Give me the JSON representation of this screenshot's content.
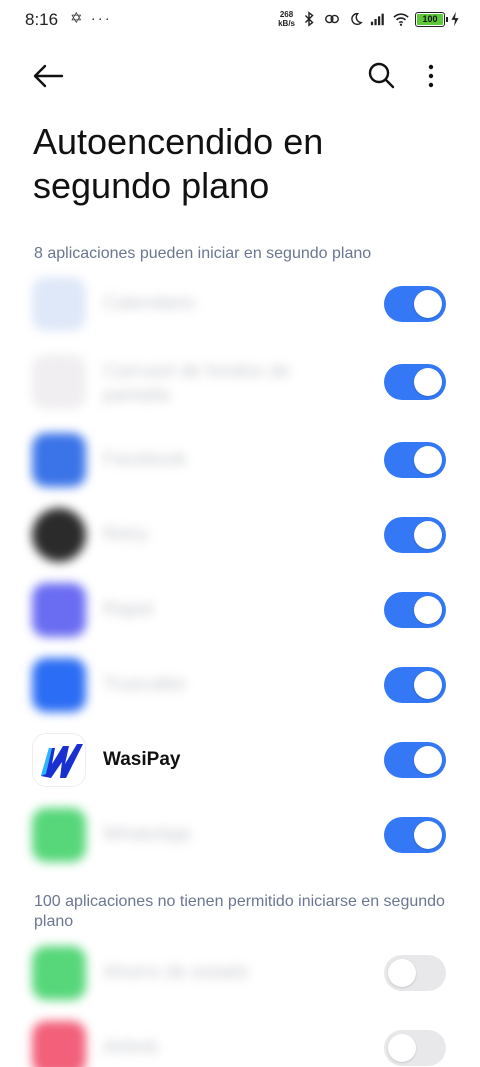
{
  "status_bar": {
    "time": "8:16",
    "left_icons": "✡ ···",
    "net_speed_value": "268",
    "net_speed_unit": "kB/s",
    "battery_level": "100"
  },
  "header": {
    "title": "Autoencendido en segundo plano"
  },
  "allowed_section": {
    "header": "8 aplicaciones pueden iniciar en segundo plano",
    "apps": [
      {
        "name": "Calendario",
        "enabled": true,
        "icon_color": "#dfe8f8",
        "label_color": "#c7c9ce"
      },
      {
        "name": "Carrusel de fondos de pantalla",
        "enabled": true,
        "icon_color": "#f0eef0",
        "label_color": "#c7c9ce"
      },
      {
        "name": "Facebook",
        "enabled": true,
        "icon_color": "#3b74e8",
        "label_color": "#c7c9ce"
      },
      {
        "name": "Retry",
        "enabled": true,
        "icon_color": "#2b2b2b",
        "label_color": "#c7c9ce"
      },
      {
        "name": "Rapid",
        "enabled": true,
        "icon_color": "#6a6cf2",
        "label_color": "#c7c9ce"
      },
      {
        "name": "Truecaller",
        "enabled": true,
        "icon_color": "#2b6df4",
        "label_color": "#c7c9ce"
      },
      {
        "name": "WasiPay",
        "enabled": true,
        "icon_color": "#ffffff",
        "label_color": "#111111"
      },
      {
        "name": "WhatsApp",
        "enabled": true,
        "icon_color": "#57d77a",
        "label_color": "#c7c9ce"
      }
    ]
  },
  "denied_section": {
    "header": "100 aplicaciones no tienen permitido iniciarse en segundo plano",
    "apps": [
      {
        "name": "Ahorro de estado",
        "enabled": false,
        "icon_color": "#57d77a",
        "label_color": "#c7c9ce"
      },
      {
        "name": "Airbnb",
        "enabled": false,
        "icon_color": "#f2607a",
        "label_color": "#c7c9ce"
      }
    ]
  },
  "colors": {
    "toggle_on": "#3478f6",
    "toggle_off": "#e8e8ea",
    "section_header": "#6b7690"
  }
}
